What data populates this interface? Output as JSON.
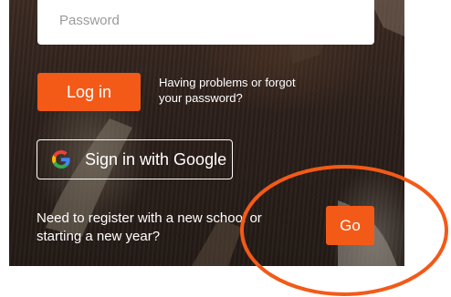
{
  "login_form": {
    "password_placeholder": "Password",
    "login_button": "Log in",
    "help_text": "Having problems or forgot your password?",
    "google_button": "Sign in with Google",
    "register_text": "Need to register with a new school or starting a new year?",
    "go_button": "Go"
  },
  "icons": {
    "google": "google-icon"
  },
  "colors": {
    "accent": "#f35a18",
    "annotation": "#f35a18",
    "panel_background": "#2b1f1a",
    "text": "#ffffff"
  }
}
